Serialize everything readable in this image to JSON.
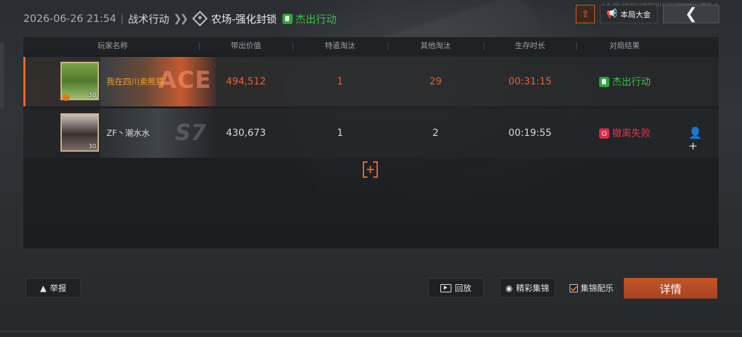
{
  "header": {
    "datetime": "2026-06-26 21:54",
    "separator": "|",
    "mode": "战术行动",
    "map": "农场-强化封锁",
    "result": "杰出行动",
    "result_color": "#3ec24a"
  },
  "build_info": "1.0.165.16523|1|0626223|1|12228536903|1|极动|~7",
  "top_actions": {
    "gold_label": "本局大金",
    "back_icon": "chevron-left-icon"
  },
  "table": {
    "columns": [
      "玩家名称",
      "带出价值",
      "特遣淘汰",
      "其他淘汰",
      "生存时长",
      "对局结果"
    ],
    "rows": [
      {
        "avatar_level": "30",
        "banner_text": "ACE",
        "name": "我在四川卖熊猫",
        "value": "494,512",
        "special_kills": "1",
        "other_kills": "29",
        "survival": "00:31:15",
        "result": "杰出行动",
        "result_color": "#3ec24a"
      },
      {
        "avatar_level": "30",
        "banner_text": "S7",
        "name": "ZF丶潮水水",
        "value": "430,673",
        "special_kills": "1",
        "other_kills": "2",
        "survival": "00:19:55",
        "result": "撤离失败",
        "result_color": "#e4344a"
      }
    ]
  },
  "footer": {
    "report": "举报",
    "replay": "回放",
    "highlights": "精彩集锦",
    "music": "集锦配乐",
    "music_checked": true,
    "detail": "详情"
  },
  "colors": {
    "accent": "#e8642a",
    "success": "#3ec24a",
    "fail": "#e4344a"
  }
}
